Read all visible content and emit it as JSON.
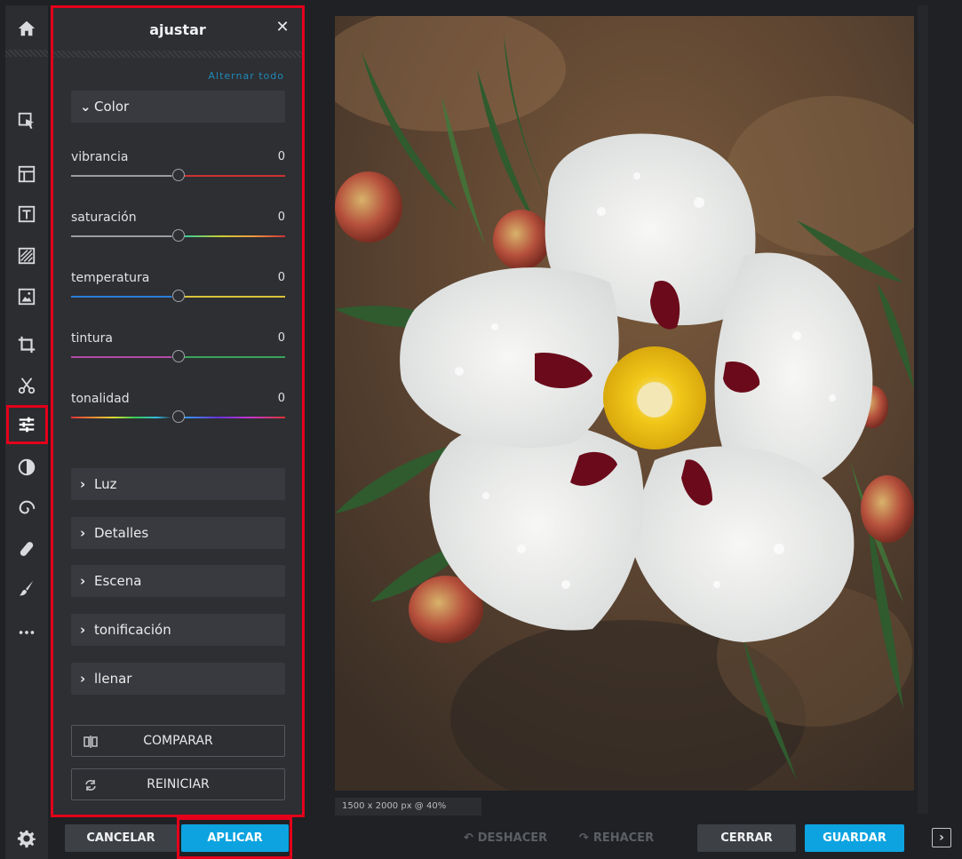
{
  "panel": {
    "title": "ajustar",
    "close_glyph": "✕",
    "toggle_all": "Alternar todo",
    "color_section": "Color",
    "sliders": [
      {
        "label": "vibrancia",
        "value": "0"
      },
      {
        "label": "saturación",
        "value": "0"
      },
      {
        "label": "temperatura",
        "value": "0"
      },
      {
        "label": "tintura",
        "value": "0"
      },
      {
        "label": "tonalidad",
        "value": "0"
      }
    ],
    "sections": [
      "Luz",
      "Detalles",
      "Escena",
      "tonificación",
      "llenar"
    ],
    "compare": "COMPARAR",
    "reset": "REINICIAR"
  },
  "canvas": {
    "dimensions": "1500 x 2000 px @ 40%"
  },
  "bottombar": {
    "cancel": "CANCELAR",
    "apply": "APLICAR",
    "undo": "DESHACER",
    "redo": "REHACER",
    "close": "CERRAR",
    "save": "GUARDAR"
  },
  "colors": {
    "accent": "#0da3e0",
    "highlight": "#e4001b"
  },
  "rail_icons": [
    "home-icon",
    "arrange-icon",
    "layout-icon",
    "text-icon",
    "texture-icon",
    "image-icon",
    "crop-icon",
    "cutout-icon",
    "adjust-icon",
    "effects-icon",
    "filter-icon",
    "retouch-icon",
    "draw-icon",
    "more-icon",
    "settings-icon"
  ]
}
